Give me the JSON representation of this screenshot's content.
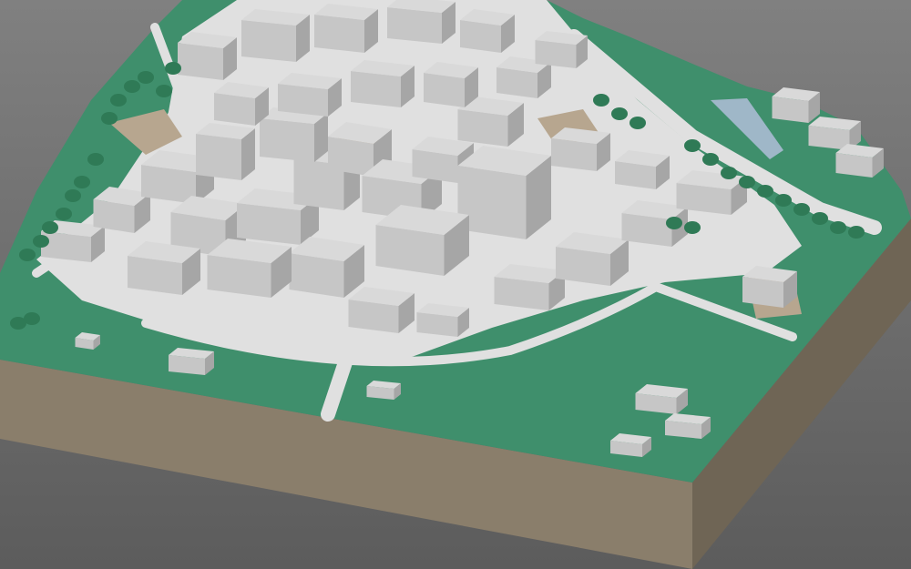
{
  "scene": {
    "type": "3d-city-block-model",
    "colors": {
      "background_top": "#808080",
      "background_bottom": "#5c5c5c",
      "terrain_green": "#3f8f6c",
      "tree_green": "#2f7a56",
      "building_roof": "#d9d9d9",
      "building_light": "#c6c6c6",
      "building_shadow": "#a6a6a6",
      "road": "#e0e0e0",
      "plaza_tan": "#b7a68f",
      "base_side_front": "#8a7e6b",
      "base_side_right": "#6f6555",
      "water": "#9fb7c8"
    }
  }
}
